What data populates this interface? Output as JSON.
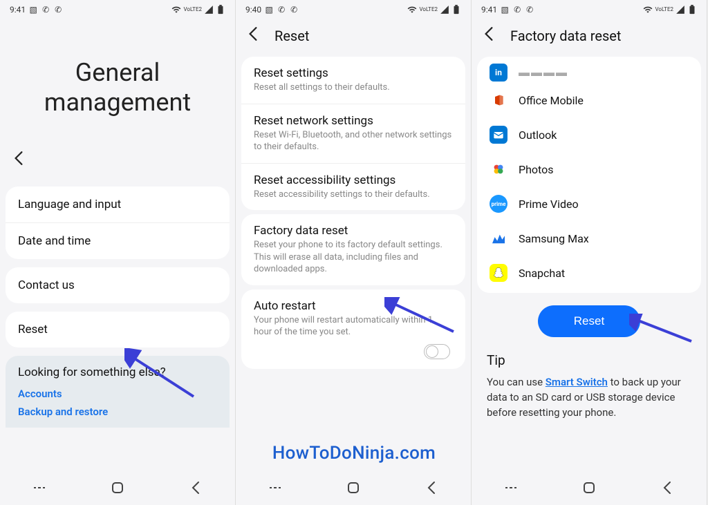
{
  "watermark": "HowToDoNinja.com",
  "screens": {
    "s1": {
      "time": "9:41",
      "title": "General management",
      "items": [
        "Language and input",
        "Date and time",
        "Contact us",
        "Reset"
      ],
      "looking": "Looking for something else?",
      "links": [
        "Accounts",
        "Backup and restore"
      ]
    },
    "s2": {
      "time": "9:40",
      "title": "Reset",
      "options": [
        {
          "t": "Reset settings",
          "d": "Reset all settings to their defaults."
        },
        {
          "t": "Reset network settings",
          "d": "Reset Wi-Fi, Bluetooth, and other network settings to their defaults."
        },
        {
          "t": "Reset accessibility settings",
          "d": "Reset accessibility settings to their defaults."
        },
        {
          "t": "Factory data reset",
          "d": "Reset your phone to its factory default settings. This will erase all data, including files and downloaded apps."
        },
        {
          "t": "Auto restart",
          "d": "Your phone will restart automatically within 1 hour of the time you set."
        }
      ]
    },
    "s3": {
      "time": "9:41",
      "title": "Factory data reset",
      "apps": [
        "Office Mobile",
        "Outlook",
        "Photos",
        "Prime Video",
        "Samsung Max",
        "Snapchat"
      ],
      "button": "Reset",
      "tip_title": "Tip",
      "tip_text_pre": "You can use ",
      "tip_link": "Smart Switch",
      "tip_text_post": " to back up your data to an SD card or USB storage device before resetting your phone."
    },
    "network_label": "VoLTE2"
  }
}
